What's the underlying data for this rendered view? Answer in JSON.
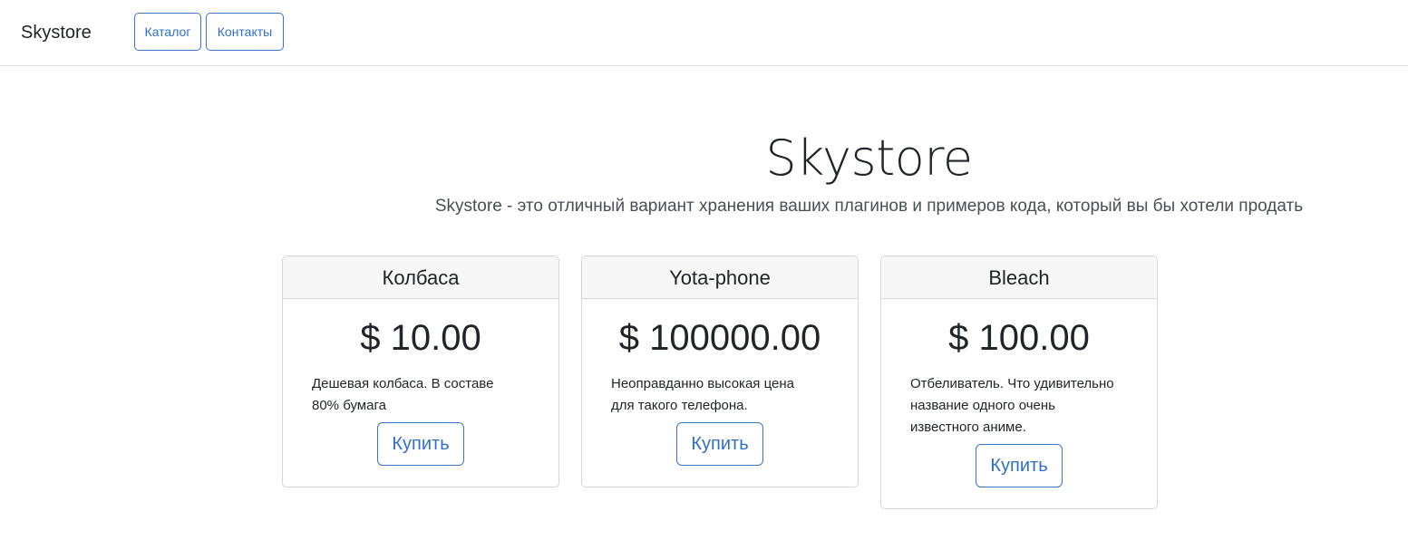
{
  "navbar": {
    "brand": "Skystore",
    "links": [
      {
        "label": "Каталог"
      },
      {
        "label": "Контакты"
      }
    ]
  },
  "hero": {
    "title": "Skystore",
    "subtitle": "Skystore - это отличный вариант хранения ваших плагинов и примеров кода, который вы бы хотели продать"
  },
  "products": [
    {
      "name": "Колбаса",
      "price": "$ 10.00",
      "description": "Дешевая колбаса. В составе 80% бумага",
      "buy_label": "Купить"
    },
    {
      "name": "Yota-phone",
      "price": "$ 100000.00",
      "description": "Неоправданно высокая цена для такого телефона.",
      "buy_label": "Купить"
    },
    {
      "name": "Bleach",
      "price": "$ 100.00",
      "description": "Отбеливатель. Что удивительно название одного очень известного аниме.",
      "buy_label": "Купить"
    }
  ],
  "colors": {
    "accent": "#2f6fc6",
    "border": "#d5d8db",
    "card_header_bg": "#f7f7f7"
  }
}
